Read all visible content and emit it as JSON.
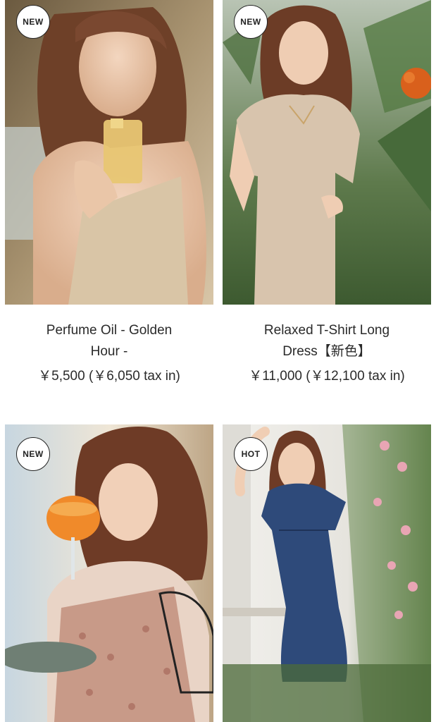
{
  "products": [
    {
      "badge": "NEW",
      "name_line1": "Perfume Oil - Golden",
      "name_line2": "Hour -",
      "price": "￥5,500 (￥6,050 tax in)",
      "image": "woman holding perfume bottle"
    },
    {
      "badge": "NEW",
      "name_line1": "Relaxed T-Shirt Long",
      "name_line2": "Dress【新色】",
      "price": "￥11,000 (￥12,100 tax in)",
      "image": "woman in beige t-shirt dress among palms"
    },
    {
      "badge": "NEW",
      "name_line1": "",
      "name_line2": "",
      "price": "",
      "image": "woman in floral dress holding drink"
    },
    {
      "badge": "HOT",
      "name_line1": "",
      "name_line2": "",
      "price": "",
      "image": "woman in denim dress near flowering wall"
    }
  ],
  "colors": {
    "text": "#2a2a2a",
    "badge_bg": "#ffffff",
    "badge_border": "#222222"
  }
}
